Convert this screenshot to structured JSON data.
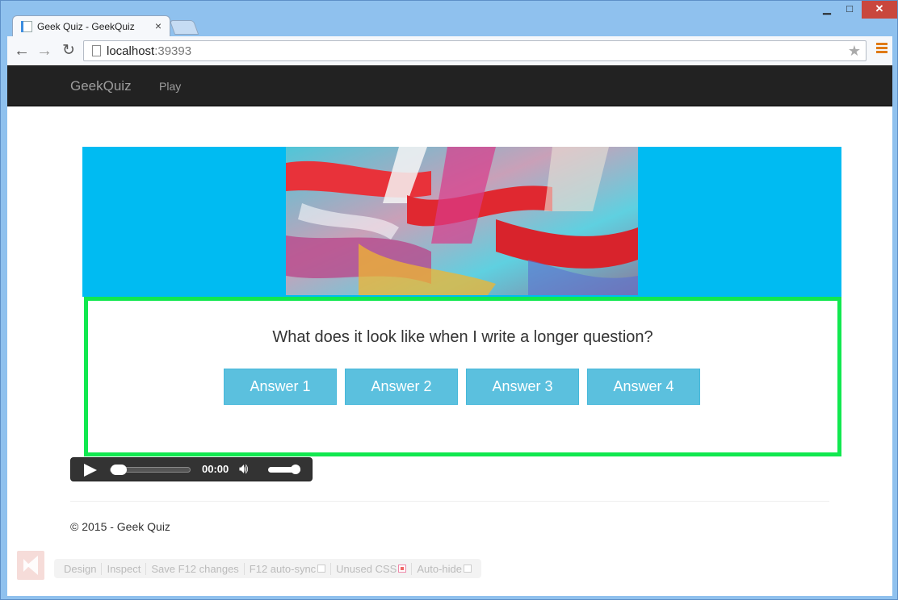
{
  "browser": {
    "tab_title": "Geek Quiz - GeekQuiz",
    "tab_close": "×",
    "url_host": "localhost",
    "url_port": ":39393",
    "window_controls": {
      "minimize": "▁",
      "maximize": "□",
      "close": "✕"
    },
    "nav": {
      "back": "←",
      "forward": "→",
      "reload": "↻",
      "star": "★"
    }
  },
  "navbar": {
    "brand": "GeekQuiz",
    "links": [
      "Play"
    ]
  },
  "quiz": {
    "question": "What does it look like when I write a longer question?",
    "answers": [
      "Answer 1",
      "Answer 2",
      "Answer 3",
      "Answer 4"
    ]
  },
  "player": {
    "time": "00:00",
    "progress": 0.0,
    "volume": 0.8
  },
  "footer": {
    "text": "© 2015 - Geek Quiz"
  },
  "browserlink": {
    "items": [
      {
        "label": "Design",
        "check": null
      },
      {
        "label": "Inspect",
        "check": null
      },
      {
        "label": "Save F12 changes",
        "check": null
      },
      {
        "label": "F12 auto-sync",
        "check": "off"
      },
      {
        "label": "Unused CSS",
        "check": "on"
      },
      {
        "label": "Auto-hide",
        "check": "off"
      }
    ]
  },
  "colors": {
    "banner": "#00bbf2",
    "card_border": "#11e84f",
    "answer_button": "#5bc0de",
    "navbar": "#222222",
    "close_button": "#c9473d"
  }
}
